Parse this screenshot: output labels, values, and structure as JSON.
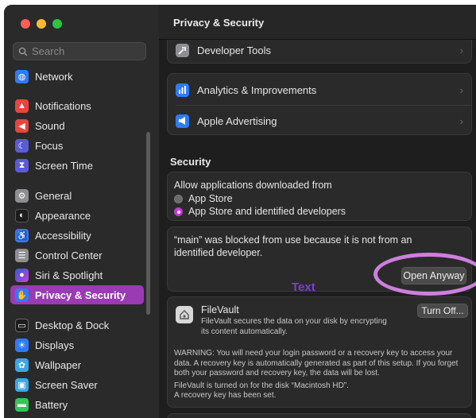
{
  "window": {
    "title": "Privacy & Security"
  },
  "search": {
    "placeholder": "Search"
  },
  "sidebar": {
    "items": [
      {
        "label": "Network",
        "icon": "globe-icon",
        "color": "#2f7bf6"
      },
      {
        "label": "Notifications",
        "icon": "bell-icon",
        "color": "#e8453c"
      },
      {
        "label": "Sound",
        "icon": "speaker-icon",
        "color": "#e8453c"
      },
      {
        "label": "Focus",
        "icon": "moon-icon",
        "color": "#5b5bd6"
      },
      {
        "label": "Screen Time",
        "icon": "hourglass-icon",
        "color": "#5b5bd6"
      },
      {
        "label": "General",
        "icon": "gear-icon",
        "color": "#8e8e93"
      },
      {
        "label": "Appearance",
        "icon": "appearance-icon",
        "color": "#1c1c1c"
      },
      {
        "label": "Accessibility",
        "icon": "accessibility-icon",
        "color": "#2f7bf6"
      },
      {
        "label": "Control Center",
        "icon": "control-center-icon",
        "color": "#8e8e93"
      },
      {
        "label": "Siri & Spotlight",
        "icon": "siri-icon",
        "color": "#3a3a8a"
      },
      {
        "label": "Privacy & Security",
        "icon": "hand-icon",
        "color": "#2f7bf6"
      },
      {
        "label": "Desktop & Dock",
        "icon": "dock-icon",
        "color": "#1c1c1c"
      },
      {
        "label": "Displays",
        "icon": "sun-icon",
        "color": "#2f7bf6"
      },
      {
        "label": "Wallpaper",
        "icon": "flower-icon",
        "color": "#38a8e8"
      },
      {
        "label": "Screen Saver",
        "icon": "screensaver-icon",
        "color": "#38a8e8"
      },
      {
        "label": "Battery",
        "icon": "battery-icon",
        "color": "#34c759"
      }
    ],
    "active_index": 10
  },
  "main": {
    "rows_top": [
      {
        "label": "Developer Tools",
        "icon": "hammer-icon"
      },
      {
        "label": "Analytics & Improvements",
        "icon": "chart-icon"
      },
      {
        "label": "Apple Advertising",
        "icon": "megaphone-icon"
      }
    ],
    "chevron": "›",
    "security": {
      "title": "Security",
      "allow_label": "Allow applications downloaded from",
      "options": [
        "App Store",
        "App Store and identified developers"
      ],
      "selected_index": 1,
      "blocked_message": "“main” was blocked from use because it is not from an identified developer.",
      "open_anyway_label": "Open Anyway",
      "annotation_text": "Text"
    },
    "filevault": {
      "title": "FileVault",
      "description": "FileVault secures the data on your disk by encrypting its content automatically.",
      "turn_off_label": "Turn Off...",
      "warning": "WARNING: You will need your login password or a recovery key to access your data. A recovery key is automatically generated as part of this setup. If you forget both your password and recovery key, the data will be lost.",
      "status_line1": "FileVault is turned on for the disk “Macintosh HD”.",
      "status_line2": "A recovery key has been set."
    }
  },
  "colors": {
    "accent": "#c43adb",
    "sidebar_selected": "#9a3bb3",
    "annotation": "#cc80dc",
    "annotation_text": "#7a3fd8"
  }
}
